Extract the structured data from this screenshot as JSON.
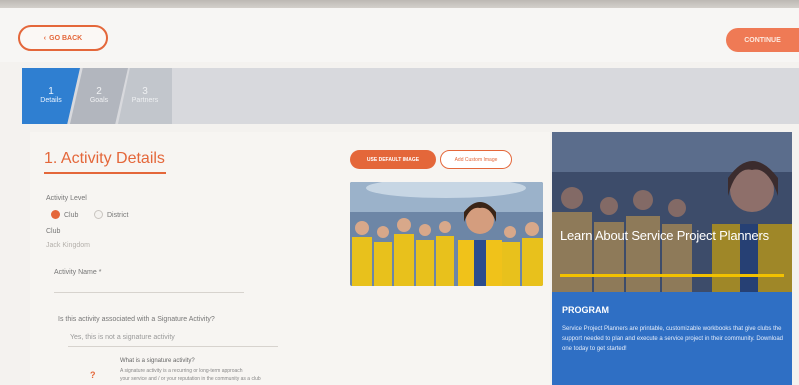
{
  "topbar": {
    "go_back_label": "GO BACK",
    "continue_label": "CONTINUE"
  },
  "steps": [
    {
      "number": "1",
      "label": "Details",
      "state": "active"
    },
    {
      "number": "2",
      "label": "Goals",
      "state": "inactive"
    },
    {
      "number": "3",
      "label": "Partners",
      "state": "inactive"
    }
  ],
  "form": {
    "title": "1. Activity Details",
    "activity_level_label": "Activity Level",
    "level_options": [
      {
        "label": "Club",
        "selected": true
      },
      {
        "label": "District",
        "selected": false
      }
    ],
    "club_label": "Club",
    "club_value": "Jack Kingdom",
    "activity_name_label": "Activity Name *",
    "signature_question": "Is this activity associated with a Signature Activity?",
    "signature_answer": "Yes, this is not a signature activity",
    "signature_info_title": "What is a signature activity?",
    "signature_info_line1": "A signature activity is a recurring or long-term approach",
    "signature_info_line2": "your service and / or your reputation in the community as a club"
  },
  "image_actions": {
    "default_label": "USE DEFAULT IMAGE",
    "custom_label": "Add Custom Image"
  },
  "promo": {
    "title": "Learn About Service Project Planners",
    "section_label": "PROGRAM",
    "body": "Service Project Planners are printable, customizable workbooks that give clubs the support needed to plan and execute a service project in their community. Download one today to get started!"
  },
  "colors": {
    "accent": "#e4673a",
    "step_active": "#2f7fd1",
    "promo_blue": "#2f6fc4",
    "promo_yellow": "#f2c100"
  },
  "icons": {
    "back": "chevron-left-icon",
    "info": "question-icon"
  }
}
